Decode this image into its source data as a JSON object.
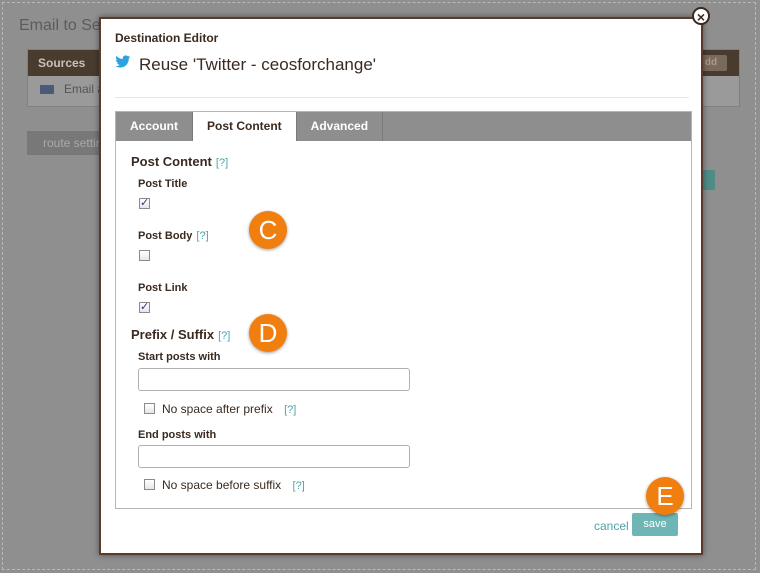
{
  "background": {
    "title": "Email to Se",
    "panel_header": "Sources",
    "panel_row": "Email a",
    "add_label": "dd",
    "route_button": "route settin"
  },
  "modal": {
    "label": "Destination Editor",
    "title": "Reuse 'Twitter - ceosforchange'",
    "tabs": [
      {
        "label": "Account",
        "active": false
      },
      {
        "label": "Post Content",
        "active": true
      },
      {
        "label": "Advanced",
        "active": false
      }
    ],
    "post_content": {
      "title": "Post Content",
      "help": "[?]",
      "fields": [
        {
          "label": "Post Title",
          "help": "",
          "checked": true
        },
        {
          "label": "Post Body",
          "help": "[?]",
          "checked": false
        },
        {
          "label": "Post Link",
          "help": "",
          "checked": true
        }
      ]
    },
    "prefix_suffix": {
      "title": "Prefix / Suffix",
      "help": "[?]",
      "start_label": "Start posts with",
      "start_value": "",
      "no_space_prefix_label": "No space after prefix",
      "no_space_prefix_help": "[?]",
      "no_space_prefix_checked": false,
      "end_label": "End posts with",
      "end_value": "",
      "no_space_suffix_label": "No space before suffix",
      "no_space_suffix_help": "[?]",
      "no_space_suffix_checked": false
    },
    "actions": {
      "cancel": "cancel",
      "save": "save"
    },
    "close_symbol": "×"
  },
  "callouts": {
    "c": "C",
    "d": "D",
    "e": "E"
  },
  "colors": {
    "accent": "#4fa3a8",
    "callout": "#f07f0f",
    "save_button": "#6fb5b5",
    "tabbar": "#8e8e8e",
    "modal_border": "#5a3a2a"
  }
}
